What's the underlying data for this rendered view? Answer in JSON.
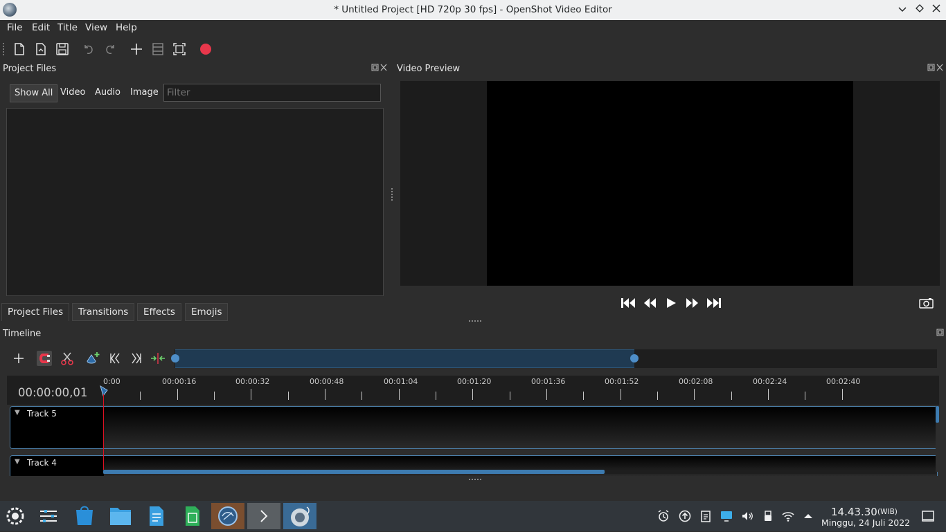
{
  "window": {
    "title": "* Untitled Project [HD 720p 30 fps] - OpenShot Video Editor",
    "controls": [
      "minimize",
      "maximize",
      "close"
    ]
  },
  "menu": [
    "File",
    "Edit",
    "Title",
    "View",
    "Help"
  ],
  "toolbar": {
    "icons": [
      "new-project-icon",
      "open-project-icon",
      "save-project-icon",
      "undo-icon",
      "redo-icon",
      "import-files-icon",
      "profile-icon",
      "fullscreen-icon",
      "export-video-icon"
    ]
  },
  "project_files": {
    "title": "Project Files",
    "filters": [
      "Show All",
      "Video",
      "Audio",
      "Image"
    ],
    "filter_placeholder": "Filter",
    "tabs": [
      "Project Files",
      "Transitions",
      "Effects",
      "Emojis"
    ]
  },
  "preview": {
    "title": "Video Preview",
    "controls": [
      "jump-start",
      "rewind",
      "play",
      "fast-forward",
      "jump-end"
    ]
  },
  "timeline": {
    "title": "Timeline",
    "current_time": "00:00:00,01",
    "ruler_labels": [
      "0:00",
      "00:00:16",
      "00:00:32",
      "00:00:48",
      "00:01:04",
      "00:01:20",
      "00:01:36",
      "00:01:52",
      "00:02:08",
      "00:02:24",
      "00:02:40"
    ],
    "tracks": [
      {
        "name": "Track 5"
      },
      {
        "name": "Track 4"
      }
    ]
  },
  "taskbar": {
    "clock_time": "14.43.30",
    "clock_tz": "(WIB)",
    "clock_date": "Minggu, 24 Juli 2022"
  }
}
